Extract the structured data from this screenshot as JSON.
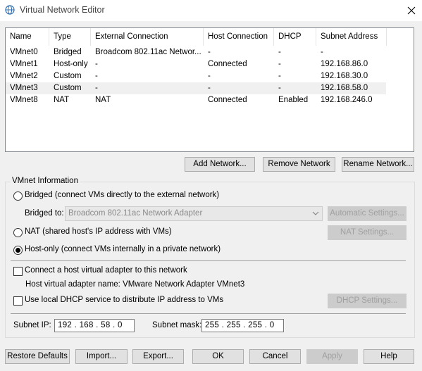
{
  "window": {
    "title": "Virtual Network Editor",
    "icon": "network-globe-icon",
    "close_icon": "close-icon"
  },
  "networks_table": {
    "columns": [
      "Name",
      "Type",
      "External Connection",
      "Host Connection",
      "DHCP",
      "Subnet Address"
    ],
    "rows": [
      [
        "VMnet0",
        "Bridged",
        "Broadcom 802.11ac Networ...",
        "-",
        "-",
        "-"
      ],
      [
        "VMnet1",
        "Host-only",
        "-",
        "Connected",
        "-",
        "192.168.86.0"
      ],
      [
        "VMnet2",
        "Custom",
        "-",
        "-",
        "-",
        "192.168.30.0"
      ],
      [
        "VMnet3",
        "Custom",
        "-",
        "-",
        "-",
        "192.168.58.0"
      ],
      [
        "VMnet8",
        "NAT",
        "NAT",
        "Connected",
        "Enabled",
        "192.168.246.0"
      ]
    ],
    "selected_row": 3
  },
  "table_buttons": {
    "add": "Add Network...",
    "remove": "Remove Network",
    "rename": "Rename Network..."
  },
  "vmnet_info": {
    "group_label": "VMnet Information",
    "bridged_label": "Bridged (connect VMs directly to the external network)",
    "bridged_to_label": "Bridged to:",
    "bridged_to_value": "Broadcom 802.11ac Network Adapter",
    "automatic_settings": "Automatic Settings...",
    "nat_label": "NAT (shared host's IP address with VMs)",
    "nat_settings": "NAT Settings...",
    "hostonly_label": "Host-only (connect VMs internally in a private network)",
    "selected_mode": "host-only",
    "connect_adapter_label": "Connect a host virtual adapter to this network",
    "connect_adapter_checked": false,
    "adapter_name_text": "Host virtual adapter name: VMware Network Adapter VMnet3",
    "dhcp_label": "Use local DHCP service to distribute IP address to VMs",
    "dhcp_checked": false,
    "dhcp_settings": "DHCP Settings...",
    "subnet_ip_label": "Subnet IP:",
    "subnet_ip_value": "192 . 168 . 58 . 0",
    "subnet_mask_label": "Subnet mask:",
    "subnet_mask_value": "255 . 255 . 255 . 0"
  },
  "footer_buttons": {
    "restore": "Restore Defaults",
    "import": "Import...",
    "export": "Export...",
    "ok": "OK",
    "cancel": "Cancel",
    "apply": "Apply",
    "help": "Help"
  },
  "colors": {
    "window_bg": "#f0f0f0",
    "selected_row": "#f0f0f0",
    "disabled_text": "#a0a0a0"
  }
}
